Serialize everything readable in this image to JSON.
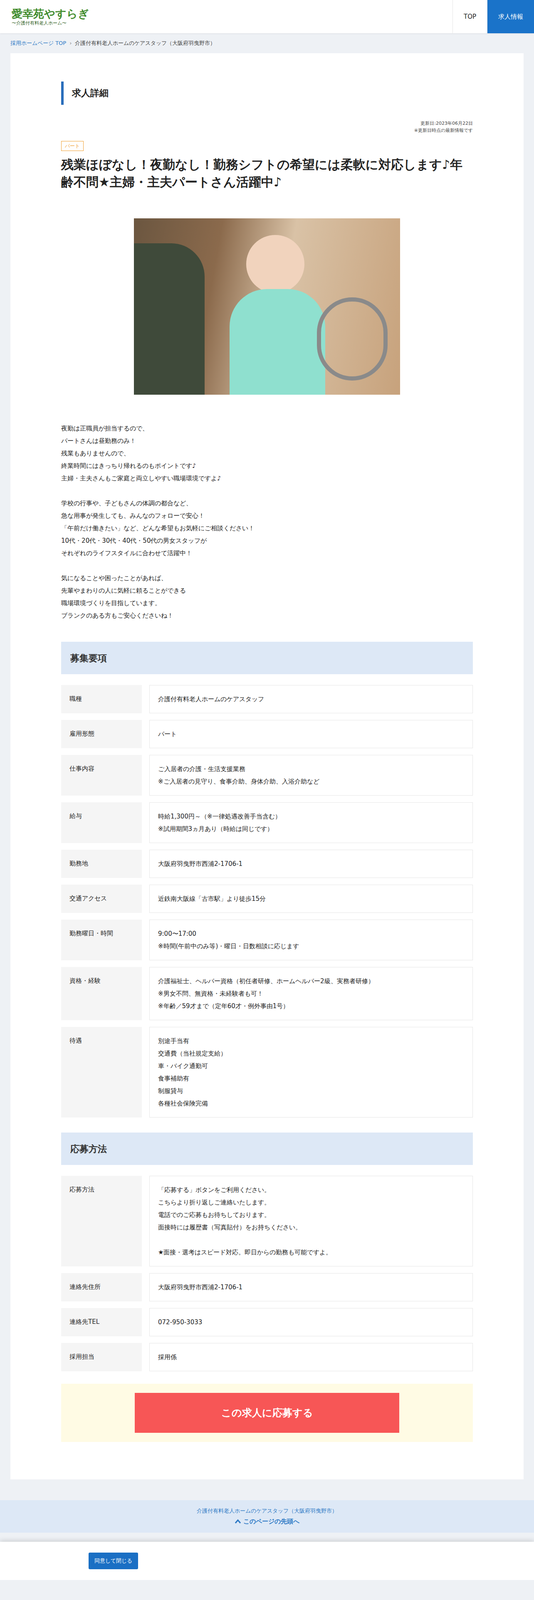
{
  "header": {
    "logo": {
      "title": "愛幸苑やすらぎ",
      "subtitle": "〜介護付有料老人ホーム〜"
    },
    "nav": [
      {
        "label": "TOP",
        "selected": false
      },
      {
        "label": "求人情報",
        "selected": true
      }
    ]
  },
  "breadcrumb": {
    "items": [
      "採用ホームページ TOP",
      "介護付有料老人ホームのケアスタッフ（大阪府羽曳野市）"
    ],
    "separator": "›"
  },
  "heading": "求人詳細",
  "updated": [
    "更新日:2023年06月22日",
    "※更新日時点の最新情報です"
  ],
  "badge": "パート",
  "title": "残業ほぼなし！夜勤なし！勤務シフトの希望には柔軟に対応します♪年齢不問★主婦・主夫パートさん活躍中♪",
  "description": [
    [
      "夜勤は正職員が担当するので、",
      "パートさんは昼勤務のみ！",
      "残業もありませんので、",
      "終業時間にはきっちり帰れるのもポイントです♪",
      "主婦・主夫さんもご家庭と両立しやすい職場環境ですよ♪"
    ],
    [
      "学校の行事や、子どもさんの体調の都合など、",
      "急な用事が発生しても、みんなのフォローで安心！",
      "「午前だけ働きたい」など、どんな希望もお気軽にご相談ください！",
      "10代・20代・30代・40代・50代の男女スタッフが",
      "それぞれのライフスタイルに合わせて活躍中！"
    ],
    [
      "気になることや困ったことがあれば、",
      "先輩やまわりの人に気軽に頼ることができる",
      "職場環境づくりを目指しています。",
      "ブランクのある方もご安心くださいね！"
    ]
  ],
  "requirements": {
    "title": "募集要項",
    "rows": [
      {
        "label": "職種",
        "lines": [
          "介護付有料老人ホームのケアスタッフ"
        ]
      },
      {
        "label": "雇用形態",
        "lines": [
          "パート"
        ]
      },
      {
        "label": "仕事内容",
        "lines": [
          "ご入居者の介護・生活支援業務",
          "※ご入居者の見守り、食事介助、身体介助、入浴介助など"
        ]
      },
      {
        "label": "給与",
        "lines": [
          "時給1,300円～（※一律処遇改善手当含む）",
          "※試用期間3ヵ月あり（時給は同じです）"
        ]
      },
      {
        "label": "勤務地",
        "lines": [
          "大阪府羽曳野市西浦2-1706-1"
        ]
      },
      {
        "label": "交通アクセス",
        "lines": [
          "近鉄南大阪線「古市駅」より徒歩15分"
        ]
      },
      {
        "label": "勤務曜日・時間",
        "lines": [
          "9:00〜17:00",
          "※時間(午前中のみ等)・曜日・日数相談に応じます"
        ]
      },
      {
        "label": "資格・経験",
        "lines": [
          "介護福祉士、ヘルパー資格（初任者研修、ホームヘルパー2級、実務者研修）",
          "※男女不問、無資格・未経験者も可！",
          "※年齢／59才まで（定年60才・例外事由1号）"
        ]
      },
      {
        "label": "待遇",
        "lines": [
          "別途手当有",
          "交通費（当社規定支給）",
          "車・バイク通勤可",
          "食事補助有",
          "制服貸与",
          "各種社会保険完備"
        ]
      }
    ]
  },
  "apply": {
    "title": "応募方法",
    "rows": [
      {
        "label": "応募方法",
        "lines": [
          "「応募する」ボタンをご利用ください。",
          "こちらより折り返しご連絡いたします。",
          "電話でのご応募もお待ちしております。",
          "面接時には履歴書（写真貼付）をお持ちください。",
          "",
          "★面接・選考はスピード対応。即日からの勤務も可能ですよ。"
        ]
      },
      {
        "label": "連絡先住所",
        "lines": [
          "大阪府羽曳野市西浦2-1706-1"
        ]
      },
      {
        "label": "連絡先TEL",
        "lines": [
          "072-950-3033"
        ]
      },
      {
        "label": "採用担当",
        "lines": [
          "採用係"
        ]
      }
    ],
    "button": "この求人に応募する"
  },
  "footer": {
    "page_title": "介護付有料老人ホームのケアスタッフ（大阪府羽曳野市）",
    "to_top": "このページの先頭へ"
  },
  "consent": {
    "button": "同意して閉じる"
  }
}
